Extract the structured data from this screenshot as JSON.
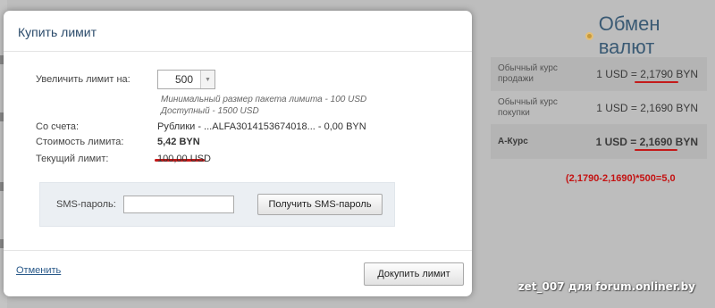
{
  "modal": {
    "title": "Купить лимит",
    "increase_label": "Увеличить лимит на:",
    "increase_value": "500",
    "hint_min": "Минимальный размер пакета лимита - 100 USD",
    "hint_available": "Доступный - 1500 USD",
    "account_label": "Со счета:",
    "account_value": "Рублики - ...ALFA3014153674018... - 0,00 BYN",
    "cost_label": "Стоимость лимита:",
    "cost_value": "5,42 BYN",
    "current_label": "Текущий лимит:",
    "current_value": "100,00 USD",
    "sms_label": "SMS-пароль:",
    "sms_value": "",
    "sms_button": "Получить SMS-пароль",
    "cancel_link": "Отменить",
    "buy_button": "Докупить лимит"
  },
  "rates": {
    "title": "Обмен валют",
    "rows": [
      {
        "label": "Обычный курс продажи",
        "prefix": "1 USD =",
        "number": "2,1790",
        "currency": "BYN",
        "highlighted": true,
        "bold": false
      },
      {
        "label": "Обычный курс покупки",
        "prefix": "1 USD =",
        "number": "2,1690",
        "currency": "BYN",
        "highlighted": false,
        "bold": false
      },
      {
        "label": "А-Курс",
        "prefix": "1 USD =",
        "number": "2,1690",
        "currency": "BYN",
        "highlighted": true,
        "bold": true
      }
    ]
  },
  "annotation": {
    "formula": "(2,1790-2,1690)*500=5,0",
    "color": "#c41212"
  },
  "watermark": "zet_007 для forum.onliner.by",
  "colors": {
    "accent_title": "#2a4a6a",
    "annotation_red": "#c41a1a",
    "overlay_gray": "#bdbdbd"
  }
}
